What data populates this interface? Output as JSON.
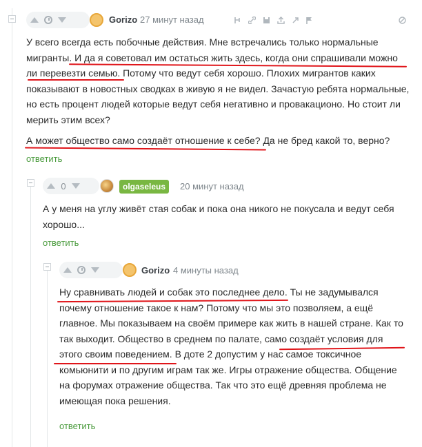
{
  "comments": [
    {
      "author": "Gorizo",
      "time": "27 минут назад",
      "votes": "",
      "text": "У всего всегда есть побочные действия. Мне встречались только нормальные мигранты. И да я советовал им остаться жить здесь, когда они спрашивали можно ли перевезти семью. Потому что ведут себя хорошо. Плохих мигрантов каких показывают в новостных сводках в живую я не видел. Зачастую ребята нормальные, но есть процент людей которые ведут себя негативно и провакационо. Но стоит ли мерить этим всех?",
      "text2": "А может общество само создаёт отношение к себе? Да не бред какой то, верно?",
      "reply": "ответить"
    },
    {
      "author": "olgaseleus",
      "time": "20 минут назад",
      "votes": "0",
      "text": "А у меня на углу живёт стая собак и пока она никого не покусала и ведут себя хорошо...",
      "reply": "ответить"
    },
    {
      "author": "Gorizo",
      "time": "4 минуты назад",
      "votes": "",
      "text": "Ну сравнивать людей и собак это последнее дело. Ты не задумывался почему отношение такое к нам? Потому что мы это позволяем, а ещё главное. Мы показываем на своём примере как жить в нашей стране. Как то так выходит. Общество в среднем по палате, само создаёт условия для этого своим поведением. В доте 2 допустим у нас самое токсичное комьюнити и по другим играм так же. Игры отражение общества. Общение на форумах отражение общества. Так что это ещё древняя проблема не имеющая пока решения.",
      "reply": "ответить"
    }
  ],
  "colors": {
    "accent_green": "#4a9b3d",
    "author_badge": "#79b742",
    "highlight_red": "#e0151a"
  }
}
